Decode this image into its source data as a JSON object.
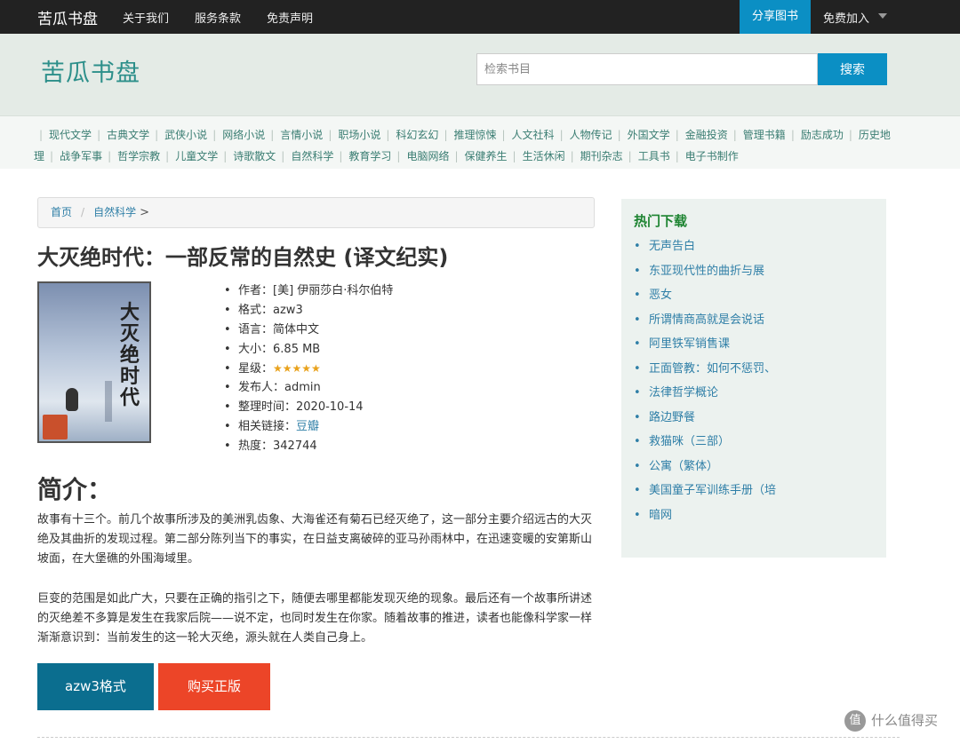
{
  "topnav": {
    "brand": "苦瓜书盘",
    "links": [
      "关于我们",
      "服务条款",
      "免责声明"
    ],
    "share": "分享图书",
    "join": "免费加入"
  },
  "header": {
    "logo": "苦瓜书盘",
    "search_placeholder": "检索书目",
    "search_button": "搜索"
  },
  "categories": [
    "现代文学",
    "古典文学",
    "武侠小说",
    "网络小说",
    "言情小说",
    "职场小说",
    "科幻玄幻",
    "推理惊悚",
    "人文社科",
    "人物传记",
    "外国文学",
    "金融投资",
    "管理书籍",
    "励志成功",
    "历史地理",
    "战争军事",
    "哲学宗教",
    "儿童文学",
    "诗歌散文",
    "自然科学",
    "教育学习",
    "电脑网络",
    "保健养生",
    "生活休闲",
    "期刊杂志",
    "工具书",
    "电子书制作"
  ],
  "breadcrumb": {
    "home": "首页",
    "category": "自然科学",
    "gt": ">"
  },
  "book": {
    "title": "大灭绝时代：一部反常的自然史 (译文纪实)",
    "cover_title": "大灭绝时代",
    "meta": {
      "author_label": "作者：",
      "author": "[美] 伊丽莎白·科尔伯特",
      "format_label": "格式：",
      "format": "azw3",
      "language_label": "语言：",
      "language": "简体中文",
      "size_label": "大小：",
      "size": "6.85 MB",
      "rating_label": "星级：",
      "rating_stars": "★★★★★",
      "rating": 5,
      "publisher_label": "发布人：",
      "publisher": "admin",
      "date_label": "整理时间：",
      "date": "2020-10-14",
      "link_label": "相关链接：",
      "link": "豆瓣",
      "heat_label": "热度：",
      "heat": "342744"
    }
  },
  "intro": {
    "heading": "简介：",
    "p1": "故事有十三个。前几个故事所涉及的美洲乳齿象、大海雀还有菊石已经灭绝了，这一部分主要介绍远古的大灭绝及其曲折的发现过程。第二部分陈列当下的事实，在日益支离破碎的亚马孙雨林中，在迅速变暖的安第斯山坡面，在大堡礁的外围海域里。",
    "p2": "巨变的范围是如此广大，只要在正确的指引之下，随便去哪里都能发现灭绝的现象。最后还有一个故事所讲述的灭绝差不多算是发生在我家后院——说不定，也同时发生在你家。随着故事的推进，读者也能像科学家一样渐渐意识到：当前发生的这一轮大灭绝，源头就在人类自己身上。"
  },
  "buttons": {
    "azw3": "azw3格式",
    "buy": "购买正版"
  },
  "sidebar": {
    "heading": "热门下载",
    "items": [
      "无声告白",
      "东亚现代性的曲折与展",
      "恶女",
      "所谓情商高就是会说话",
      "阿里铁军销售课",
      "正面管教：如何不惩罚、",
      "法律哲学概论",
      "路边野餐",
      "救猫咪（三部）",
      "公寓（繁体）",
      "美国童子军训练手册（培",
      "暗网"
    ]
  },
  "watermark": {
    "icon_text": "值",
    "text": "什么值得买"
  },
  "colors": {
    "topnav_bg": "#222222",
    "accent_blue": "#0b8fc4",
    "buy_red": "#ec4528",
    "logo_teal": "#2c8f8a",
    "sidebar_heading_green": "#1d8431",
    "star_gold": "#e9a21c"
  }
}
